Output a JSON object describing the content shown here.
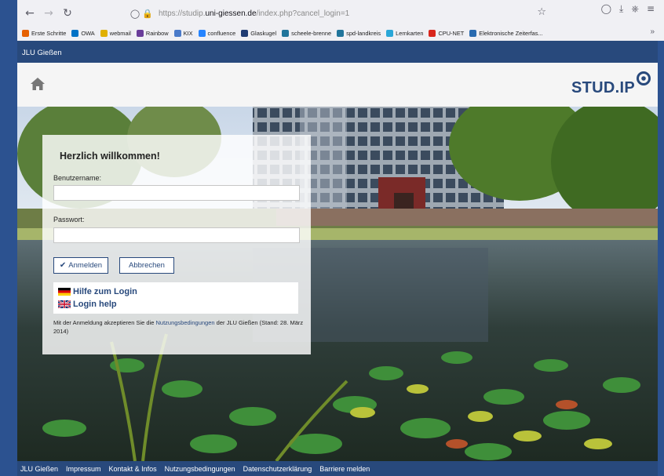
{
  "browser": {
    "url_host_prefix": "https://studip.",
    "url_host": "uni-giessen.de",
    "url_path": "/index.php?cancel_login=1",
    "bookmarks": [
      {
        "label": "Erste Schritte",
        "color": "#e66000"
      },
      {
        "label": "OWA",
        "color": "#0072c6"
      },
      {
        "label": "webmail",
        "color": "#e0b000"
      },
      {
        "label": "Rainbow",
        "color": "#6a3d9a"
      },
      {
        "label": "KIX",
        "color": "#4a7ac9"
      },
      {
        "label": "confluence",
        "color": "#2684ff"
      },
      {
        "label": "Glaskugel",
        "color": "#1f3b73"
      },
      {
        "label": "scheele-brenne",
        "color": "#21759b"
      },
      {
        "label": "spd-landkreis",
        "color": "#21759b"
      },
      {
        "label": "Lernkarten",
        "color": "#2aa7d8"
      },
      {
        "label": "CPU-NET",
        "color": "#d9261c"
      },
      {
        "label": "Elektronische Zeiterfas...",
        "color": "#2a6bb0"
      }
    ]
  },
  "site": {
    "topbar_title": "JLU Gießen",
    "logo_text": "STUD.IP",
    "accent": "#28497c"
  },
  "login": {
    "title": "Herzlich willkommen!",
    "username_label": "Benutzername:",
    "password_label": "Passwort:",
    "submit_label": "Anmelden",
    "cancel_label": "Abbrechen",
    "help_de": "Hilfe zum Login",
    "help_en": "Login help",
    "terms_before": "Mit der Anmeldung akzeptieren Sie die ",
    "terms_link": "Nutzungsbedingungen",
    "terms_after": " der JLU Gießen (Stand: 28. März 2014)"
  },
  "footer": {
    "links": [
      "JLU Gießen",
      "Impressum",
      "Kontakt & Infos",
      "Nutzungsbedingungen",
      "Datenschutzerklärung",
      "Barriere melden"
    ]
  }
}
